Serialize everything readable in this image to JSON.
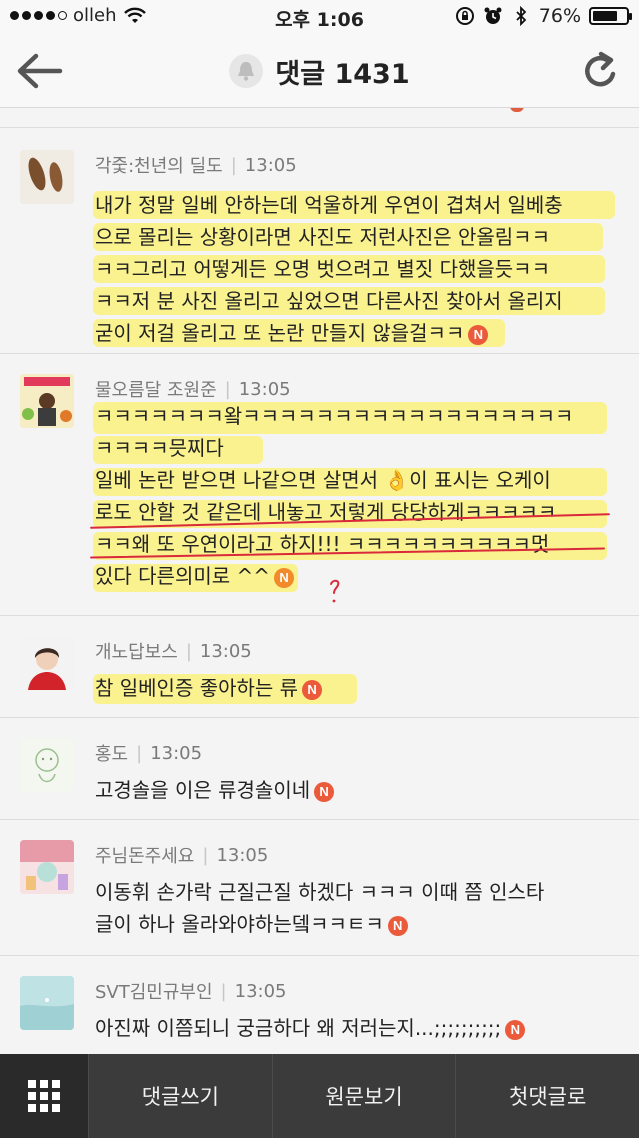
{
  "status_bar": {
    "carrier": "olleh",
    "time": "오후 1:06",
    "battery_percent": "76%",
    "battery_level": 0.76,
    "signal_bars_filled": 4,
    "signal_bars_total": 5
  },
  "nav": {
    "title": "댓글 1431",
    "icons": {
      "back": "back-arrow-icon",
      "bell": "bell-icon",
      "refresh": "refresh-icon"
    }
  },
  "comments": [
    {
      "author": "각줓:천년의 딜도",
      "time": "13:05",
      "lines": [
        "내가 정말 일베 안하는데 억울하게 우연이 겹쳐서 일베충",
        "으로 몰리는 상황이라면 사진도 저런사진은 안올림ㅋㅋ",
        "ㅋㅋ그리고 어떻게든 오명 벗으려고 별짓 다했을듯ㅋㅋ",
        "ㅋㅋ저 분 사진 올리고 싶었으면 다른사진 찾아서 올리지",
        "굳이 저걸 올리고 또 논란 만들지 않을걸ㅋㅋ"
      ],
      "badge": "N"
    },
    {
      "author": "물오름달 조원준",
      "time": "13:05",
      "lines": [
        "ㅋㅋㅋㅋㅋㅋㅋ왘ㅋㅋㅋㅋㅋㅋㅋㅋㅋㅋㅋㅋㅋㅋㅋㅋㅋㅋ",
        "ㅋㅋㅋㅋ믓찌다",
        "일베 논란 받으면 나같으면 살면서 👌이 표시는 오케이",
        "로도 안할 것 같은데 내놓고 저렇게 당당하게ㅋㅋㅋㅋㅋ",
        "ㅋㅋ왜 또 우연이라고 하지!!! ㅋㅋㅋㅋㅋㅋㅋㅋㅋㅋ멋",
        "있다 다른의미로 ^^"
      ],
      "badge": "N"
    },
    {
      "author": "개노답보스",
      "time": "13:05",
      "lines": [
        "참 일베인증 좋아하는 류"
      ],
      "badge": "N"
    },
    {
      "author": "홍도",
      "time": "13:05",
      "lines": [
        "고경솔을 이은 류경솔이네"
      ],
      "badge": "N"
    },
    {
      "author": "주님돈주세요",
      "time": "13:05",
      "lines": [
        "이동휘 손가락 근질근질 하겠다 ㅋㅋㅋ 이때 쯤 인스타",
        "글이 하나 올라와야하는뎈ㅋㅋㅌㅋ"
      ],
      "badge": "N"
    },
    {
      "author": "SVT김민규부인",
      "time": "13:05",
      "lines": [
        "아진짜 이쯤되니 궁금하다 왜 저러는지...;;;;;;;;;;"
      ],
      "badge": "N"
    }
  ],
  "bottom_bar": {
    "menu_icon": "grid-menu-icon",
    "buttons": [
      "댓글쓰기",
      "원문보기",
      "첫댓글로"
    ]
  },
  "colors": {
    "badge_red": "#ea5a3b",
    "badge_orange": "#f08a2a",
    "highlight_yellow": "#fff03c",
    "underline_red": "#d9293a",
    "bottom_bar": "#3b3b3b"
  }
}
